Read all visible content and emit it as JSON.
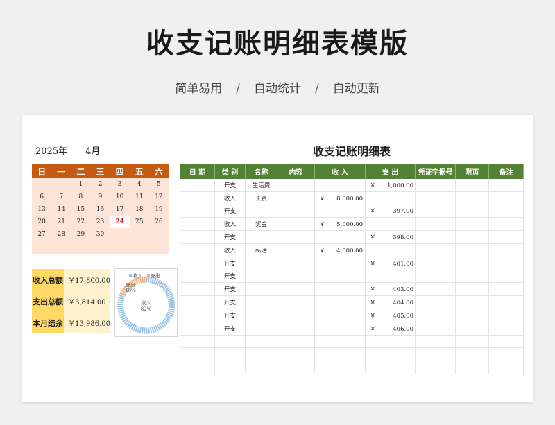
{
  "page": {
    "title": "收支记账明细表模版",
    "features": [
      "简单易用",
      "自动统计",
      "自动更新"
    ],
    "separator": "/"
  },
  "colors": {
    "calendar_header": "#c55a11",
    "calendar_body": "#fce4d6",
    "summary_label": "#ffd966",
    "summary_value": "#fff2cc",
    "ledger_header": "#548235",
    "today": "#d81e3a",
    "income_ring": "#9dc3e6",
    "expense_ring": "#f4b183"
  },
  "calendar": {
    "year": "2025年",
    "month": "4月",
    "weekdays": [
      "日",
      "一",
      "二",
      "三",
      "四",
      "五",
      "六"
    ],
    "weeks": [
      [
        "",
        "",
        "1",
        "2",
        "3",
        "4",
        "5"
      ],
      [
        "6",
        "7",
        "8",
        "9",
        "10",
        "11",
        "12"
      ],
      [
        "13",
        "14",
        "15",
        "16",
        "17",
        "18",
        "19"
      ],
      [
        "20",
        "21",
        "22",
        "23",
        "24",
        "25",
        "26"
      ],
      [
        "27",
        "28",
        "29",
        "30",
        "",
        "",
        ""
      ]
    ],
    "today": "24"
  },
  "summary": {
    "income_label": "收入总额",
    "income_value": "￥17,800.00",
    "expense_label": "支出总额",
    "expense_value": "￥3,814.00",
    "balance_label": "本月结余",
    "balance_value": "￥13,986.00"
  },
  "chart_data": {
    "type": "pie",
    "style": "donut",
    "slices": [
      {
        "label": "收入",
        "percent_label": "82%",
        "value": 82,
        "color": "#9dc3e6"
      },
      {
        "label": "支出",
        "percent_label": "18%",
        "value": 18,
        "color": "#f4b183"
      }
    ]
  },
  "ledger": {
    "title": "收支记账明细表",
    "headers": [
      "日 期",
      "类 别",
      "名称",
      "内容",
      "收 入",
      "支 出",
      "凭证字据号",
      "附页",
      "备注"
    ],
    "currency": "￥",
    "rows": [
      {
        "type": "开支",
        "name": "生活费",
        "income": "",
        "expense": "1,000.00"
      },
      {
        "type": "收入",
        "name": "工资",
        "income": "8,000.00",
        "expense": ""
      },
      {
        "type": "开支",
        "name": "",
        "income": "",
        "expense": "397.00"
      },
      {
        "type": "收入",
        "name": "奖金",
        "income": "5,000.00",
        "expense": ""
      },
      {
        "type": "开支",
        "name": "",
        "income": "",
        "expense": "398.00"
      },
      {
        "type": "收入",
        "name": "私活",
        "income": "4,800.00",
        "expense": ""
      },
      {
        "type": "开支",
        "name": "",
        "income": "",
        "expense": "401.00"
      },
      {
        "type": "开支",
        "name": "",
        "income": "",
        "expense": ""
      },
      {
        "type": "开支",
        "name": "",
        "income": "",
        "expense": "403.00"
      },
      {
        "type": "开支",
        "name": "",
        "income": "",
        "expense": "404.00"
      },
      {
        "type": "开支",
        "name": "",
        "income": "",
        "expense": "405.00"
      },
      {
        "type": "开支",
        "name": "",
        "income": "",
        "expense": "406.00"
      },
      {
        "type": "",
        "name": "",
        "income": "",
        "expense": ""
      },
      {
        "type": "",
        "name": "",
        "income": "",
        "expense": ""
      },
      {
        "type": "",
        "name": "",
        "income": "",
        "expense": ""
      }
    ]
  }
}
